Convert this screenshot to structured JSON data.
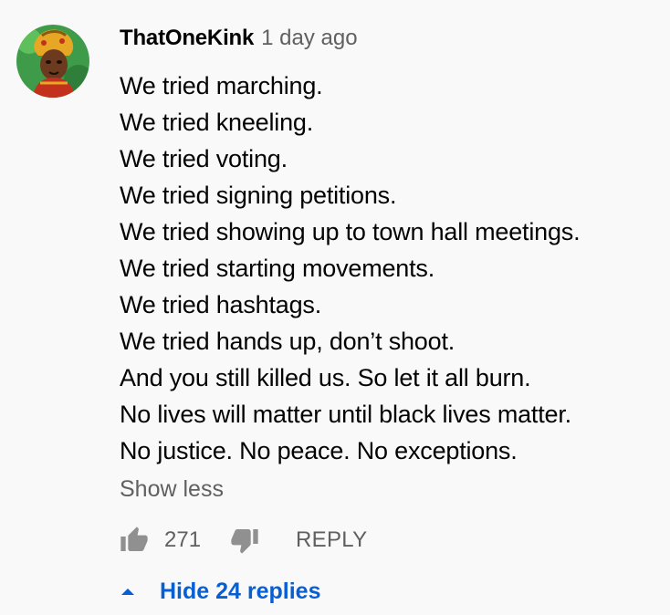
{
  "comment": {
    "author": "ThatOneKink",
    "timestamp": "1 day ago",
    "lines": [
      "We tried marching.",
      "We tried kneeling.",
      "We tried voting.",
      "We tried signing petitions.",
      "We tried showing up to town hall meetings.",
      "We tried starting movements.",
      "We tried hashtags.",
      "We tried hands up, don’t shoot.",
      "And you still killed us. So let it all burn.",
      "No lives will matter until black lives matter.",
      "No justice. No peace. No exceptions."
    ],
    "show_less_label": "Show less"
  },
  "actions": {
    "like_icon": "thumbs-up-icon",
    "like_count": "271",
    "dislike_icon": "thumbs-down-icon",
    "reply_label": "REPLY"
  },
  "replies": {
    "caret_icon": "caret-up-icon",
    "toggle_label": "Hide 24 replies"
  },
  "colors": {
    "background": "#f9f9f9",
    "text_primary": "#030303",
    "text_secondary": "#606060",
    "link_blue": "#065fd4"
  }
}
